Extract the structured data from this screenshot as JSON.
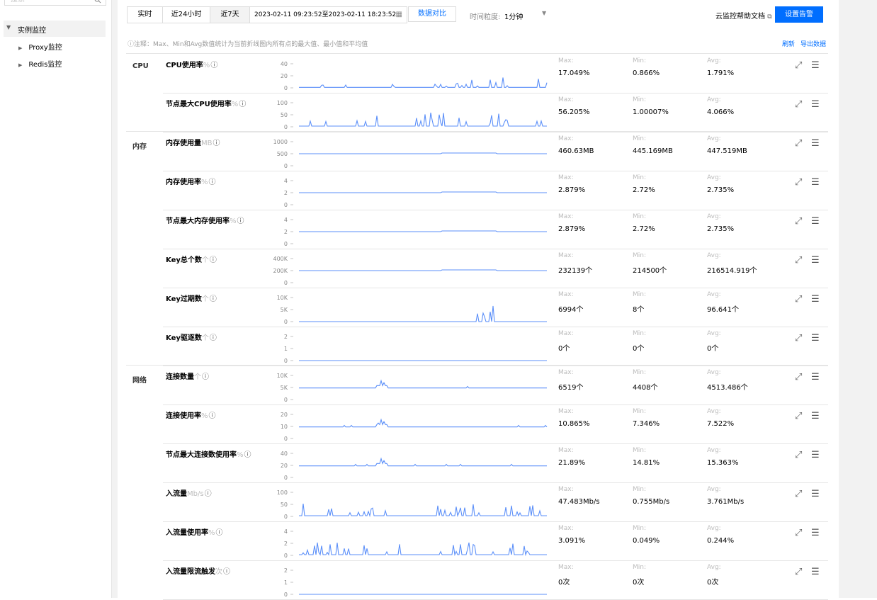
{
  "sidebar": {
    "search_placeholder": "搜索",
    "root": "实例监控",
    "children": [
      "Proxy监控",
      "Redis监控"
    ]
  },
  "toolbar": {
    "segments": [
      "实时",
      "近24小时",
      "近7天"
    ],
    "active_segment": "近7天",
    "range": "2023-02-11 09:23:52至2023-02-11 18:23:52",
    "compare": "数据对比",
    "granularity_label": "时间粒度:",
    "granularity_value": "1分钟",
    "help_link": "云监控帮助文档",
    "alarm_button": "设置告警"
  },
  "note": "注释：Max、Min和Avg数值统计为当前折线图内所有点的最大值、最小值和平均值",
  "actions": {
    "refresh": "刷新",
    "export": "导出数据"
  },
  "stat_labels": {
    "max": "Max:",
    "min": "Min:",
    "avg": "Avg:"
  },
  "sections": [
    {
      "name": "CPU",
      "row": 0
    },
    {
      "name": "内存",
      "row": 2
    },
    {
      "name": "网络",
      "row": 8
    }
  ],
  "metrics": [
    {
      "name": "CPU使用率",
      "unit": "%",
      "ticks": [
        "40",
        "20",
        "0"
      ],
      "max": "17.049%",
      "min": "0.866%",
      "avg": "1.791%",
      "pattern": "spiky-low"
    },
    {
      "name": "节点最大CPU使用率",
      "unit": "%",
      "ticks": [
        "100",
        "50",
        "0"
      ],
      "max": "56.205%",
      "min": "1.00007%",
      "avg": "4.066%",
      "pattern": "spiky-mid"
    },
    {
      "name": "内存使用量",
      "unit": "MB",
      "ticks": [
        "1000",
        "500",
        "0"
      ],
      "max": "460.63MB",
      "min": "445.169MB",
      "avg": "447.519MB",
      "pattern": "flat-mid"
    },
    {
      "name": "内存使用率",
      "unit": "%",
      "ticks": [
        "4",
        "2",
        "0"
      ],
      "max": "2.879%",
      "min": "2.72%",
      "avg": "2.735%",
      "pattern": "flat-mid"
    },
    {
      "name": "节点最大内存使用率",
      "unit": "%",
      "ticks": [
        "4",
        "2",
        "0"
      ],
      "max": "2.879%",
      "min": "2.72%",
      "avg": "2.735%",
      "pattern": "flat-mid"
    },
    {
      "name": "Key总个数",
      "unit": "个",
      "ticks": [
        "400K",
        "200K",
        "0"
      ],
      "max": "232139个",
      "min": "214500个",
      "avg": "216514.919个",
      "pattern": "flat-mid"
    },
    {
      "name": "Key过期数",
      "unit": "个",
      "ticks": [
        "10K",
        "5K",
        "0"
      ],
      "max": "6994个",
      "min": "8个",
      "avg": "96.641个",
      "pattern": "late-spikes"
    },
    {
      "name": "Key驱逐数",
      "unit": "个",
      "ticks": [
        "2",
        "1",
        "0"
      ],
      "max": "0个",
      "min": "0个",
      "avg": "0个",
      "pattern": "zero"
    },
    {
      "name": "连接数量",
      "unit": "个",
      "ticks": [
        "10K",
        "5K",
        "0"
      ],
      "max": "6519个",
      "min": "4408个",
      "avg": "4513.486个",
      "pattern": "flat-bump"
    },
    {
      "name": "连接使用率",
      "unit": "%",
      "ticks": [
        "20",
        "10",
        "0"
      ],
      "max": "10.865%",
      "min": "7.346%",
      "avg": "7.522%",
      "pattern": "flat-bump"
    },
    {
      "name": "节点最大连接数使用率",
      "unit": "%",
      "ticks": [
        "40",
        "20",
        "0"
      ],
      "max": "21.89%",
      "min": "14.81%",
      "avg": "15.363%",
      "pattern": "flat-bump"
    },
    {
      "name": "入流量",
      "unit": "Mb/s",
      "ticks": [
        "100",
        "50",
        "0"
      ],
      "max": "47.483Mb/s",
      "min": "0.755Mb/s",
      "avg": "3.761Mb/s",
      "pattern": "spiky-all"
    },
    {
      "name": "入流量使用率",
      "unit": "%",
      "ticks": [
        "4",
        "2",
        "0"
      ],
      "max": "3.091%",
      "min": "0.049%",
      "avg": "0.244%",
      "pattern": "spiky-all"
    },
    {
      "name": "入流量限流触发",
      "unit": "次",
      "ticks": [
        "2",
        "1",
        "0"
      ],
      "max": "0次",
      "min": "0次",
      "avg": "0次",
      "pattern": "zero"
    }
  ],
  "colors": {
    "accent": "#006eff",
    "line": "#5b8ff9"
  }
}
